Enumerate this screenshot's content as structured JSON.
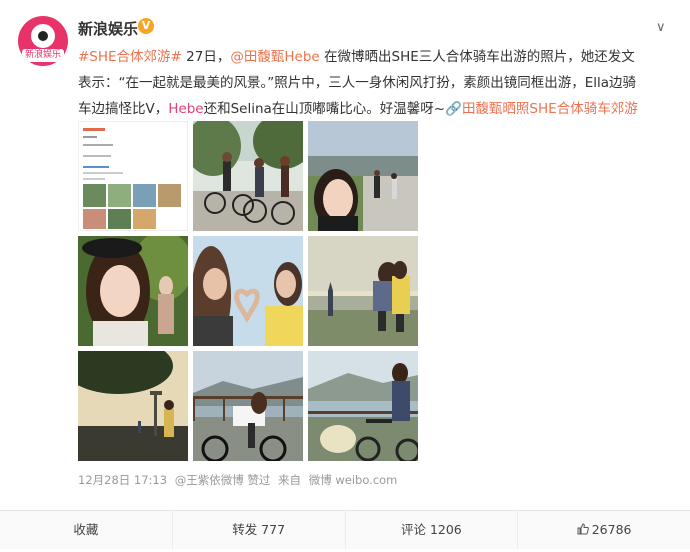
{
  "account": {
    "name": "新浪娱乐",
    "avatar_tag": "新浪娱乐",
    "verified_glyph": "V"
  },
  "post": {
    "hashtag": "#SHE合体郊游#",
    "date_text": " 27日，",
    "mention": "@田馥甄Hebe",
    "body_part1": " 在微博晒出SHE三人合体骑车出游的照片，她还发文表示：“在一起就是最美的风景。”照片中，三人一身休闲风打扮，素颜出镜同框出游，Ella边骑车边搞怪比V，",
    "hebe_name": "Hebe",
    "body_part2": "还和Selina在山顶嘟嘴比心。好温馨呀~",
    "link_icon": "🔗",
    "link_text": "田馥甄晒照SHE合体骑车郊游"
  },
  "meta": {
    "time": "12月28日 17:13",
    "via": "@王紫依微博 赞过",
    "source_prefix": "来自",
    "source": "微博 weibo.com"
  },
  "actions": {
    "favorite": "收藏",
    "repost": "转发 777",
    "comment": "评论 1206",
    "like": "26786"
  },
  "photos": [
    {
      "name": "photo-screenshot-collage",
      "desc": ""
    },
    {
      "name": "photo-three-cyclists-road"
    },
    {
      "name": "photo-selfie-cycling-view"
    },
    {
      "name": "photo-selfie-forest"
    },
    {
      "name": "photo-heart-hands-sky"
    },
    {
      "name": "photo-hug-city-sunset"
    },
    {
      "name": "photo-tree-sunset-silhouette"
    },
    {
      "name": "photo-cyclist-railing-lake"
    },
    {
      "name": "photo-cyclist-lake-view"
    }
  ],
  "colors": {
    "hashtag": "#eb7350",
    "mention": "#3a7ec1",
    "hebe": "#e3407a",
    "avatar": "#e8336a",
    "verified": "#f6a623"
  }
}
